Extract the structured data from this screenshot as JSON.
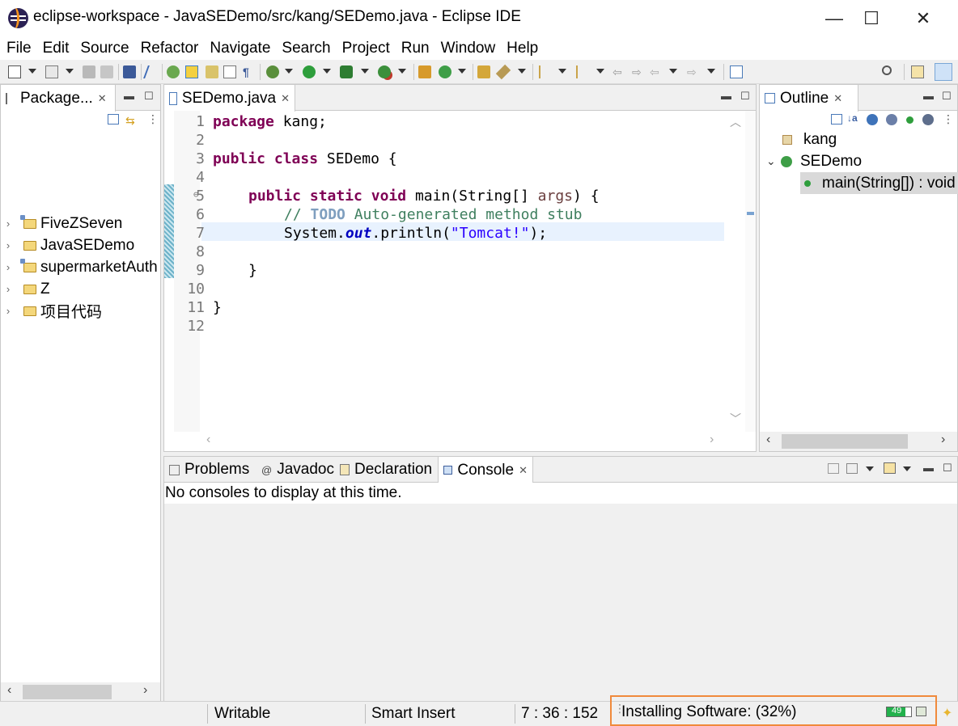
{
  "window": {
    "title": "eclipse-workspace - JavaSEDemo/src/kang/SEDemo.java - Eclipse IDE",
    "minimize": "—",
    "maximize": "☐",
    "close": "✕"
  },
  "menu": [
    "File",
    "Edit",
    "Source",
    "Refactor",
    "Navigate",
    "Search",
    "Project",
    "Run",
    "Window",
    "Help"
  ],
  "package_explorer": {
    "tab": "Package...",
    "projects": [
      "FiveZSeven",
      "JavaSEDemo",
      "supermarketAuth",
      "Z",
      "项目代码"
    ]
  },
  "editor": {
    "tab": "SEDemo.java",
    "lines": [
      "1",
      "2",
      "3",
      "4",
      "5",
      "6",
      "7",
      "8",
      "9",
      "10",
      "11",
      "12"
    ],
    "code": {
      "l1_kw": "package",
      "l1_rest": " kang;",
      "l3_kw1": "public",
      "l3_kw2": "class",
      "l3_rest": " SEDemo {",
      "l5_kw1": "public",
      "l5_kw2": "static",
      "l5_kw3": "void",
      "l5_rest": " main(String[] ",
      "l5_arg": "args",
      "l5_end": ") {",
      "l6_comment_start": "// ",
      "l6_todo": "TODO",
      "l6_comment_end": " Auto-generated method stub",
      "l7_start": "System.",
      "l7_field": "out",
      "l7_mid": ".println(",
      "l7_string": "\"Tomcat!\"",
      "l7_end": ");",
      "l9": "}",
      "l11": "}"
    }
  },
  "outline": {
    "tab": "Outline",
    "package": "kang",
    "class": "SEDemo",
    "method": "main(String[]) : void"
  },
  "bottom": {
    "tabs": [
      "Problems",
      "Javadoc",
      "Declaration",
      "Console"
    ],
    "console_message": "No consoles to display at this time."
  },
  "status": {
    "writable": "Writable",
    "insert_mode": "Smart Insert",
    "position": "7 : 36 : 152",
    "progress_text": "Installing Software: (32%)",
    "progress_fraction": 0.32,
    "heap": "49"
  },
  "colors": {
    "highlight_border": "#f08a3c",
    "progress_green": "#22b14c",
    "keyword": "#7f0055",
    "comment": "#3f7f5f",
    "string": "#2a00ff"
  }
}
